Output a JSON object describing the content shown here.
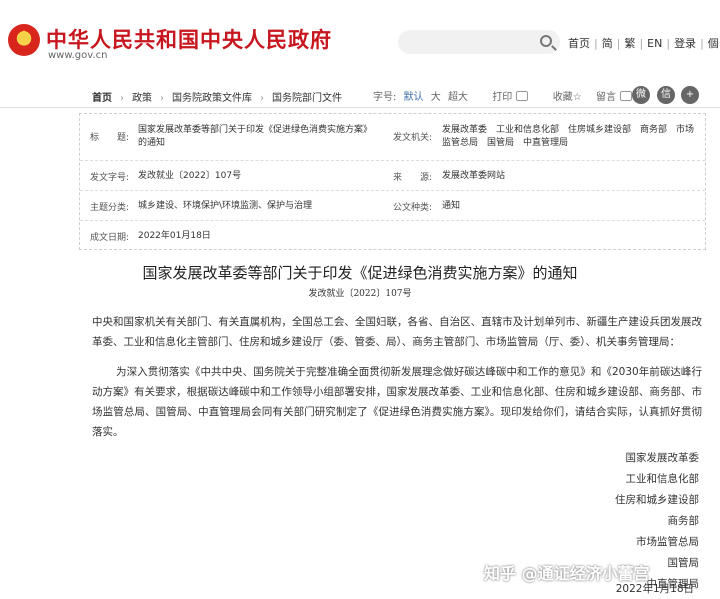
{
  "header": {
    "site_title": "中华人民共和国中央人民政府",
    "site_url": "www.gov.cn",
    "nav": [
      "首页",
      "简",
      "繁",
      "EN",
      "登录",
      "個"
    ]
  },
  "breadcrumb": {
    "items": [
      "首页",
      "政策",
      "国务院政策文件库",
      "国务院部门文件"
    ]
  },
  "tools": {
    "font_label": "字号:",
    "font_options": [
      "默认",
      "大",
      "超大"
    ],
    "print": "打印",
    "favorite": "收藏",
    "comment": "留言"
  },
  "info": {
    "title_label": "标　　题:",
    "title_value": "国家发展改革委等部门关于印发《促进绿色消费实施方案》的通知",
    "issuer_label": "发文机关:",
    "issuer_value": "发展改革委　工业和信息化部　住房城乡建设部　商务部　市场监管总局　国管局　中直管理局",
    "docno_label": "发文字号:",
    "docno_value": "发改就业〔2022〕107号",
    "source_label": "来　　源:",
    "source_value": "发展改革委网站",
    "category_label": "主题分类:",
    "category_value": "城乡建设、环境保护\\环境监测、保护与治理",
    "type_label": "公文种类:",
    "type_value": "通知",
    "date_label": "成文日期:",
    "date_value": "2022年01月18日"
  },
  "article": {
    "title": "国家发展改革委等部门关于印发《促进绿色消费实施方案》的通知",
    "number": "发改就业〔2022〕107号",
    "p1": "中央和国家机关有关部门、有关直属机构，全国总工会、全国妇联，各省、自治区、直辖市及计划单列市、新疆生产建设兵团发展改革委、工业和信息化主管部门、住房和城乡建设厅（委、管委、局）、商务主管部门、市场监管局（厅、委）、机关事务管理局：",
    "p2": "为深入贯彻落实《中共中央、国务院关于完整准确全面贯彻新发展理念做好碳达峰碳中和工作的意见》和《2030年前碳达峰行动方案》有关要求，根据碳达峰碳中和工作领导小组部署安排，国家发展改革委、工业和信息化部、住房和城乡建设部、商务部、市场监管总局、国管局、中直管理局会同有关部门研究制定了《促进绿色消费实施方案》。现印发给你们，请结合实际，认真抓好贯彻落实。",
    "signers": [
      "国家发展改革委",
      "工业和信息化部",
      "住房和城乡建设部",
      "商务部",
      "市场监管总局",
      "国管局",
      "中直管理局"
    ],
    "date": "2022年1月18日",
    "watermark": "知乎 @通证经济小蕾宫"
  }
}
